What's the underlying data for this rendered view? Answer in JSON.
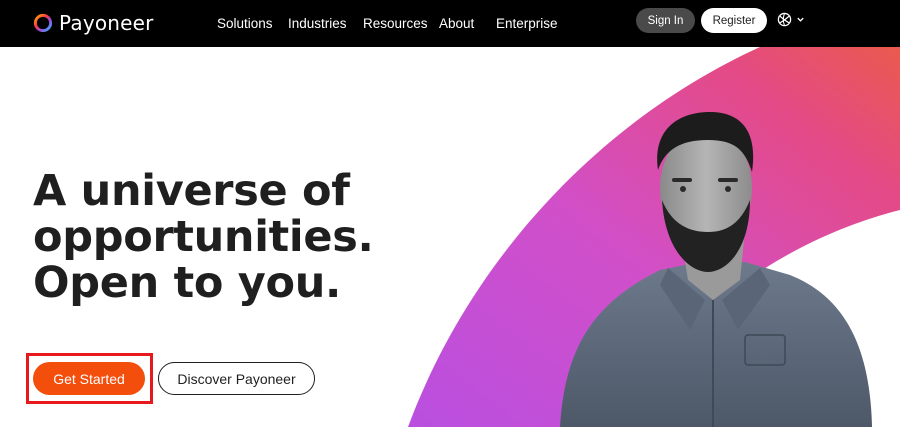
{
  "brand": {
    "name": "Payoneer"
  },
  "nav": {
    "items": [
      {
        "label": "Solutions"
      },
      {
        "label": "Industries"
      },
      {
        "label": "Resources"
      },
      {
        "label": "About"
      },
      {
        "label": "Enterprise"
      }
    ],
    "signin_label": "Sign In",
    "register_label": "Register",
    "language_icon": "globe-icon"
  },
  "hero": {
    "headline_lines": [
      "A universe of",
      "opportunities.",
      "Open to you."
    ],
    "cta_primary": "Get Started",
    "cta_secondary": "Discover Payoneer"
  },
  "colors": {
    "nav_bg": "#000000",
    "accent_orange": "#f34e0b",
    "highlight_red": "#e8191c",
    "gradient_pink": "#e04a8c",
    "gradient_purple": "#c64ad8"
  }
}
